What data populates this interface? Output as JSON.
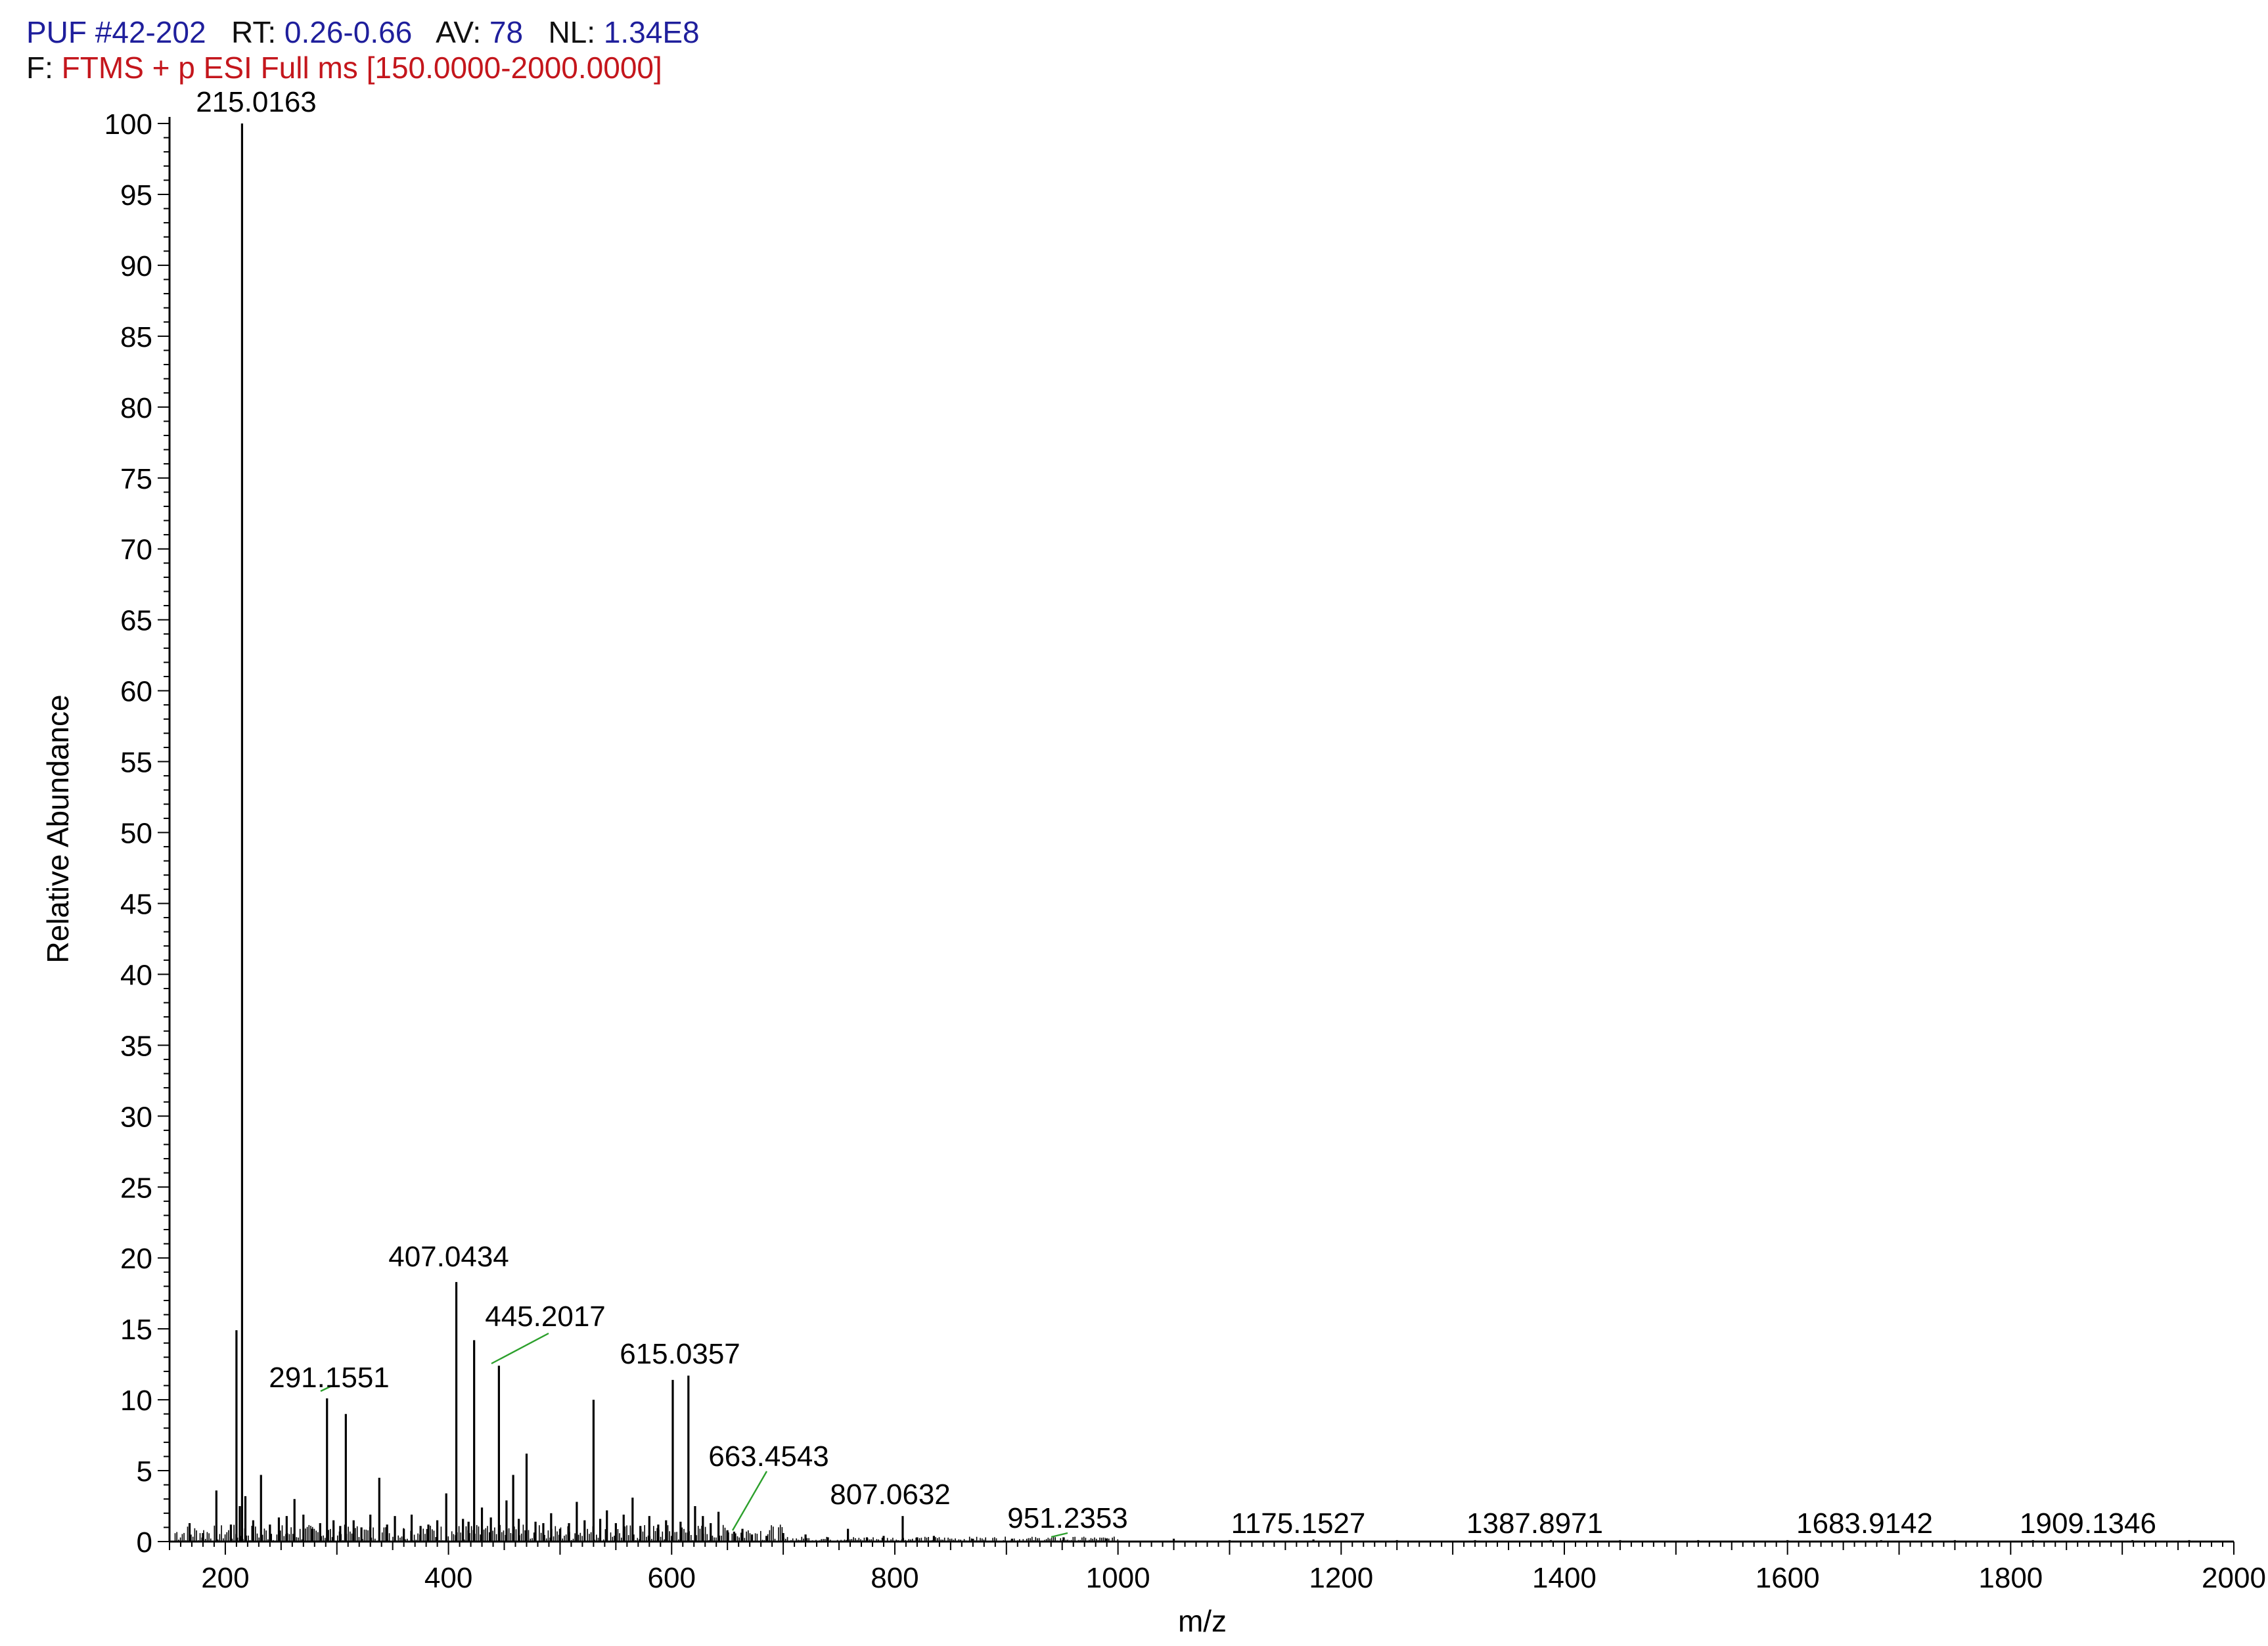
{
  "header": {
    "scan_label": "PUF",
    "scan_value": "#42-202",
    "rt_label": "RT:",
    "rt_value": "0.26-0.66",
    "av_label": "AV:",
    "av_value": "78",
    "nl_label": "NL:",
    "nl_value": "1.34E8",
    "filter_label": "F:",
    "filter_value": "FTMS + p ESI Full ms [150.0000-2000.0000]"
  },
  "colors": {
    "header_value": "#1f1f9c",
    "filter_value": "#c4161c",
    "peak_line": "#000000",
    "label_leader": "#2ca02c"
  },
  "chart_data": {
    "type": "line",
    "xlabel": "m/z",
    "ylabel": "Relative Abundance",
    "xlim": [
      150,
      2000
    ],
    "ylim": [
      0,
      100
    ],
    "x_ticks": [
      200,
      400,
      600,
      800,
      1000,
      1200,
      1400,
      1600,
      1800,
      2000
    ],
    "y_ticks": [
      0,
      5,
      10,
      15,
      20,
      25,
      30,
      35,
      40,
      45,
      50,
      55,
      60,
      65,
      70,
      75,
      80,
      85,
      90,
      95,
      100
    ],
    "series": [
      {
        "x": [
          168,
          180,
          192,
          205,
          210,
          213,
          215.0163,
          218,
          225,
          232,
          240,
          248,
          255,
          262,
          270,
          278,
          285,
          291.1551,
          297,
          303,
          308,
          315,
          322,
          330,
          338,
          345,
          352,
          360,
          367,
          375,
          382,
          390,
          398,
          407.0434,
          413,
          418,
          423,
          430,
          438,
          445.2017,
          452,
          458,
          463,
          470,
          478,
          485,
          492,
          500,
          508,
          515,
          522,
          530,
          536,
          542,
          550,
          557,
          565,
          572,
          580,
          588,
          595,
          601,
          608,
          615.0357,
          621,
          628,
          635,
          642,
          650,
          656,
          663.4543,
          672,
          685,
          700,
          720,
          740,
          758,
          775,
          790,
          807.0632,
          820,
          835,
          870,
          905,
          951.2353,
          990,
          1050,
          1100,
          1175.1527,
          1250,
          1320,
          1387.8971,
          1450,
          1520,
          1600,
          1683.9142,
          1750,
          1820,
          1909.1346,
          1960
        ],
        "values": [
          1.3,
          0.6,
          3.6,
          1.2,
          14.9,
          2.5,
          100,
          3.2,
          1.5,
          4.7,
          1.2,
          1.7,
          1.8,
          3.0,
          1.9,
          0.9,
          1.3,
          10.1,
          1.5,
          1.1,
          9.0,
          1.5,
          1.0,
          1.9,
          4.5,
          1.2,
          1.8,
          0.9,
          1.9,
          1.1,
          1.2,
          1.5,
          3.4,
          18.3,
          1.6,
          1.4,
          14.2,
          2.4,
          1.7,
          12.4,
          2.9,
          4.7,
          1.6,
          6.2,
          1.4,
          1.3,
          2.0,
          0.9,
          1.3,
          2.8,
          1.5,
          10.0,
          1.6,
          2.2,
          1.3,
          1.9,
          3.1,
          1.1,
          1.8,
          1.2,
          1.5,
          11.4,
          1.4,
          11.7,
          2.5,
          1.8,
          1.3,
          2.1,
          0.8,
          0.7,
          0.9,
          0.5,
          0.4,
          0.6,
          0.5,
          0.3,
          0.9,
          0.3,
          0.4,
          1.8,
          0.3,
          0.4,
          0.2,
          0.2,
          0.3,
          0.2,
          0.2,
          0.1,
          0.15,
          0.1,
          0.1,
          0.1,
          0.1,
          0.1,
          0.1,
          0.1,
          0.1,
          0.1,
          0.1,
          0.1
        ]
      }
    ],
    "annotations": [
      {
        "label": "215.0163",
        "x": 215.0163,
        "y": 100
      },
      {
        "label": "407.0434",
        "x": 407.0434,
        "y": 18.3
      },
      {
        "label": "445.2017",
        "x": 445.2017,
        "y": 12.4
      },
      {
        "label": "291.1551",
        "x": 291.1551,
        "y": 10.1
      },
      {
        "label": "615.0357",
        "x": 615.0357,
        "y": 11.7
      },
      {
        "label": "663.4543",
        "x": 663.4543,
        "y": 0.9
      },
      {
        "label": "807.0632",
        "x": 807.0632,
        "y": 1.8
      },
      {
        "label": "951.2353",
        "x": 951.2353,
        "y": 0.3
      },
      {
        "label": "1175.1527",
        "x": 1175.1527,
        "y": 0.15
      },
      {
        "label": "1387.8971",
        "x": 1387.8971,
        "y": 0.1
      },
      {
        "label": "1683.9142",
        "x": 1683.9142,
        "y": 0.1
      },
      {
        "label": "1909.1346",
        "x": 1909.1346,
        "y": 0.1
      }
    ],
    "grid": false,
    "legend": "none"
  }
}
